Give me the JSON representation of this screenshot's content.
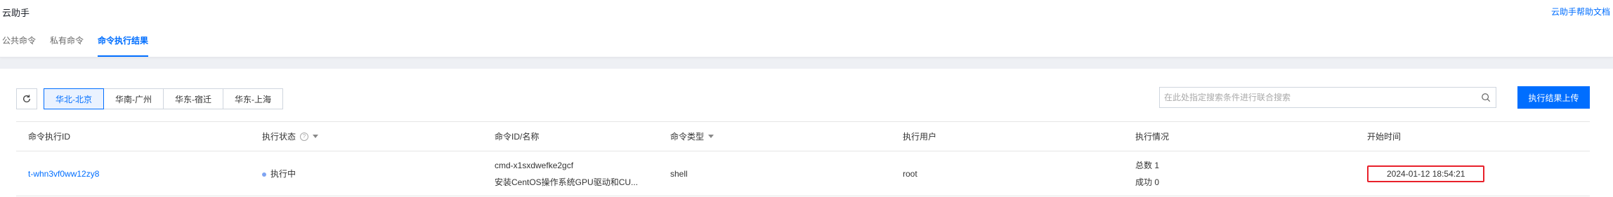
{
  "header": {
    "title": "云助手",
    "help_link": "云助手帮助文档"
  },
  "tabs": [
    {
      "label": "公共命令",
      "active": false
    },
    {
      "label": "私有命令",
      "active": false
    },
    {
      "label": "命令执行结果",
      "active": true
    }
  ],
  "toolbar": {
    "refresh_icon": "refresh-icon",
    "regions": [
      {
        "label": "华北-北京",
        "active": true
      },
      {
        "label": "华南-广州",
        "active": false
      },
      {
        "label": "华东-宿迁",
        "active": false
      },
      {
        "label": "华东-上海",
        "active": false
      }
    ],
    "search_placeholder": "在此处指定搜索条件进行联合搜索",
    "upload_button": "执行结果上传"
  },
  "table": {
    "columns": [
      "命令执行ID",
      "执行状态",
      "命令ID/名称",
      "命令类型",
      "执行用户",
      "执行情况",
      "开始时间"
    ],
    "rows": [
      {
        "exec_id": "t-whn3vf0ww12zy8",
        "status": "执行中",
        "cmd_id": "cmd-x1sxdwefke2gcf",
        "cmd_name": "安装CentOS操作系统GPU驱动和CU...",
        "cmd_type": "shell",
        "user": "root",
        "total": "总数 1",
        "success": "成功 0",
        "start_time": "2024-01-12 18:54:21"
      }
    ]
  },
  "colors": {
    "accent": "#006eff",
    "highlight_box": "#e8202a",
    "status_running": "#7fa4f2"
  }
}
